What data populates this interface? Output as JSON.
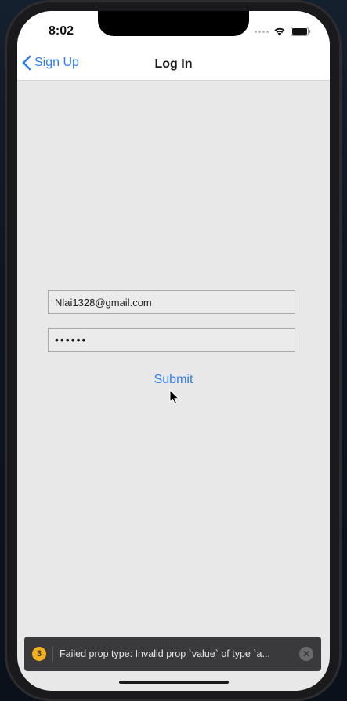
{
  "status_bar": {
    "time": "8:02",
    "icons": [
      "signal-icon",
      "wifi-icon",
      "battery-icon"
    ]
  },
  "nav": {
    "back_label": "Sign Up",
    "title": "Log In"
  },
  "form": {
    "email_value": "Nlai1328@gmail.com",
    "password_value": "••••••",
    "submit_label": "Submit"
  },
  "toast": {
    "badge_count": "3",
    "message": "Failed prop type: Invalid prop `value` of type `a...",
    "close_glyph": "✕"
  },
  "colors": {
    "accent": "#2f7cf6",
    "warning": "#f2b01e",
    "toast_bg": "#3a3a3c"
  }
}
